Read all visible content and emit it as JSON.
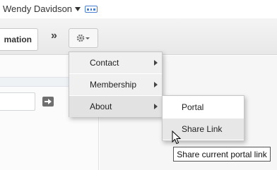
{
  "user": {
    "name": "Wendy Davidson"
  },
  "toolbar": {
    "info_tab_label": "mation",
    "more_label": "»"
  },
  "menu": {
    "items": [
      {
        "label": "Contact",
        "has_submenu": true
      },
      {
        "label": "Membership",
        "has_submenu": true
      },
      {
        "label": "About",
        "has_submenu": true
      }
    ]
  },
  "submenu": {
    "items": [
      {
        "label": "Portal"
      },
      {
        "label": "Share Link"
      }
    ]
  },
  "tooltip": {
    "text": "Share current portal link"
  },
  "colors": {
    "accent": "#4a7fd0",
    "menu_bg": "#f0f0f0"
  },
  "icons": {
    "apps": "grid-icon",
    "settings": "gear-icon",
    "go": "arrow-right-icon"
  }
}
